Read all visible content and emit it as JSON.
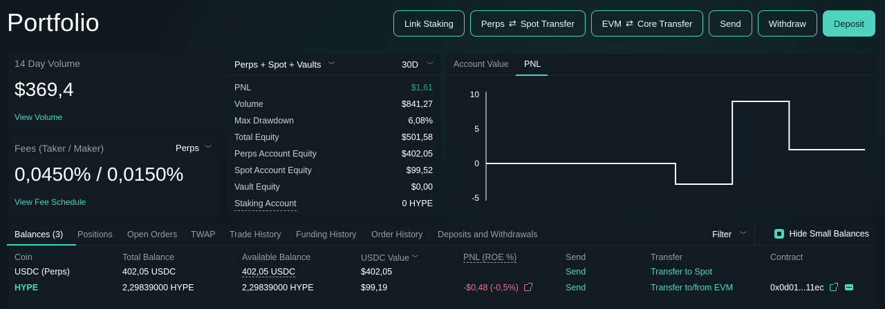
{
  "page": {
    "title": "Portfolio"
  },
  "actions": {
    "link_staking": "Link Staking",
    "perps_spot_transfer_a": "Perps",
    "perps_spot_transfer_b": "Spot Transfer",
    "evm_core_transfer_a": "EVM",
    "evm_core_transfer_b": "Core Transfer",
    "send": "Send",
    "withdraw": "Withdraw",
    "deposit": "Deposit"
  },
  "volume": {
    "label": "14 Day Volume",
    "value": "$369,4",
    "link": "View Volume"
  },
  "fees": {
    "label": "Fees (Taker / Maker)",
    "selector": "Perps",
    "value": "0,0450% / 0,0150%",
    "link": "View Fee Schedule"
  },
  "stats": {
    "scope": "Perps + Spot + Vaults",
    "period": "30D",
    "rows": [
      {
        "label": "PNL",
        "value": "$1,61"
      },
      {
        "label": "Volume",
        "value": "$841,27"
      },
      {
        "label": "Max Drawdown",
        "value": "6,08%"
      },
      {
        "label": "Total Equity",
        "value": "$501,58"
      },
      {
        "label": "Perps Account Equity",
        "value": "$402,05"
      },
      {
        "label": "Spot Account Equity",
        "value": "$99,52"
      },
      {
        "label": "Vault Equity",
        "value": "$0,00"
      },
      {
        "label": "Staking Account",
        "value": "0 HYPE"
      }
    ]
  },
  "chart_tabs": {
    "account_value": "Account Value",
    "pnl": "PNL"
  },
  "chart_data": {
    "type": "line",
    "step": true,
    "title": "",
    "xlabel": "",
    "ylabel": "",
    "ylim": [
      -5,
      10
    ],
    "yticks": [
      "10",
      "5",
      "0",
      "-5"
    ],
    "grid": false,
    "series": [
      {
        "x": [
          0,
          0.5,
          0.5,
          0.65,
          0.65,
          0.8,
          0.8,
          1.0
        ],
        "values": [
          0,
          0,
          -3,
          -3,
          9,
          9,
          2,
          2
        ]
      }
    ]
  },
  "tabs": {
    "balances": "Balances (3)",
    "positions": "Positions",
    "open_orders": "Open Orders",
    "twap": "TWAP",
    "trade_history": "Trade History",
    "funding_history": "Funding History",
    "order_history": "Order History",
    "deposits_withdrawals": "Deposits and Withdrawals",
    "filter": "Filter",
    "hide_small": "Hide Small Balances"
  },
  "table": {
    "headers": {
      "coin": "Coin",
      "total_balance": "Total Balance",
      "available_balance": "Available Balance",
      "usdc_value": "USDC Value",
      "pnl": "PNL (ROE %)",
      "send": "Send",
      "transfer": "Transfer",
      "contract": "Contract"
    },
    "rows": [
      {
        "coin": "USDC (Perps)",
        "total": "402,05 USDC",
        "available": "402,05 USDC",
        "usdc_value": "$402,05",
        "pnl": "",
        "send": "Send",
        "transfer": "Transfer to Spot",
        "contract": ""
      },
      {
        "coin": "HYPE",
        "total": "2,29839000 HYPE",
        "available": "2,29839000 HYPE",
        "usdc_value": "$99,19",
        "pnl": "-$0,48 (-0,5%)",
        "send": "Send",
        "transfer": "Transfer to/from EVM",
        "contract": "0x0d01...11ec"
      }
    ]
  },
  "colors": {
    "accent": "#50d2c1",
    "background": "#0f1a1f",
    "positive": "#1fa67d",
    "negative": "#ed7088"
  }
}
